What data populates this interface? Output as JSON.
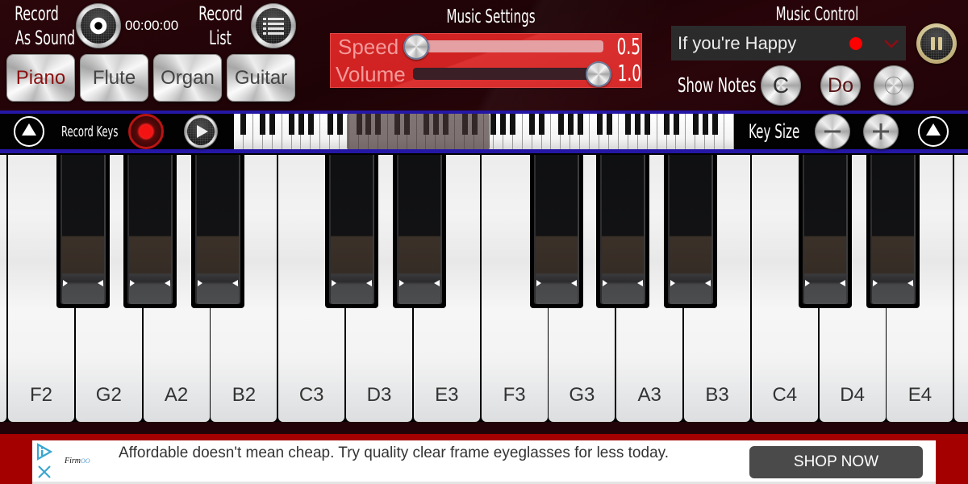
{
  "top_bar": {
    "record_sound": {
      "label_line1": "Record",
      "label_line2": "As Sound",
      "button_icon": "record-icon",
      "timer": "00:00:00"
    },
    "record_list": {
      "label_line1": "Record",
      "label_line2": "List",
      "button_icon": "list-icon"
    },
    "instruments": [
      {
        "label": "Piano",
        "selected": true
      },
      {
        "label": "Flute",
        "selected": false
      },
      {
        "label": "Organ",
        "selected": false
      },
      {
        "label": "Guitar",
        "selected": false
      }
    ],
    "music_settings": {
      "title": "Music Settings",
      "speed": {
        "label": "Speed",
        "value": "0.5",
        "slider_fraction": 0.0
      },
      "volume": {
        "label": "Volume",
        "value": "1.0",
        "slider_fraction": 1.0
      }
    },
    "music_control": {
      "title": "Music Control",
      "song": "If you're Happy",
      "status_dot_color": "#ff0000",
      "play_state_icon": "pause-icon"
    },
    "show_notes": {
      "label": "Show Notes",
      "options": [
        "C",
        "Do",
        ""
      ]
    }
  },
  "key_strip": {
    "record_keys_label": "Record Keys",
    "key_size_label": "Key Size",
    "mini_keyboard": {
      "white_key_count": 52,
      "first_note": "A0",
      "viewport_start_key": 11.7,
      "viewport_end_key": 26.6
    }
  },
  "keyboard": {
    "white_keys": [
      "F2",
      "G2",
      "A2",
      "B2",
      "C3",
      "D3",
      "E3",
      "F3",
      "G3",
      "A3",
      "B3",
      "C4",
      "D4",
      "E4"
    ]
  },
  "ad": {
    "brand_main": "Firm",
    "brand_accent": "OO",
    "text": "Affordable doesn't mean cheap. Try quality clear frame eyeglasses for less today.",
    "cta": "SHOP NOW"
  },
  "colors": {
    "accent_red": "#d42a2a",
    "piano_selected": "#8b1111",
    "strip_border": "#2517a6",
    "ad_band": "#a50000",
    "pause_ring": "#cfc092"
  }
}
